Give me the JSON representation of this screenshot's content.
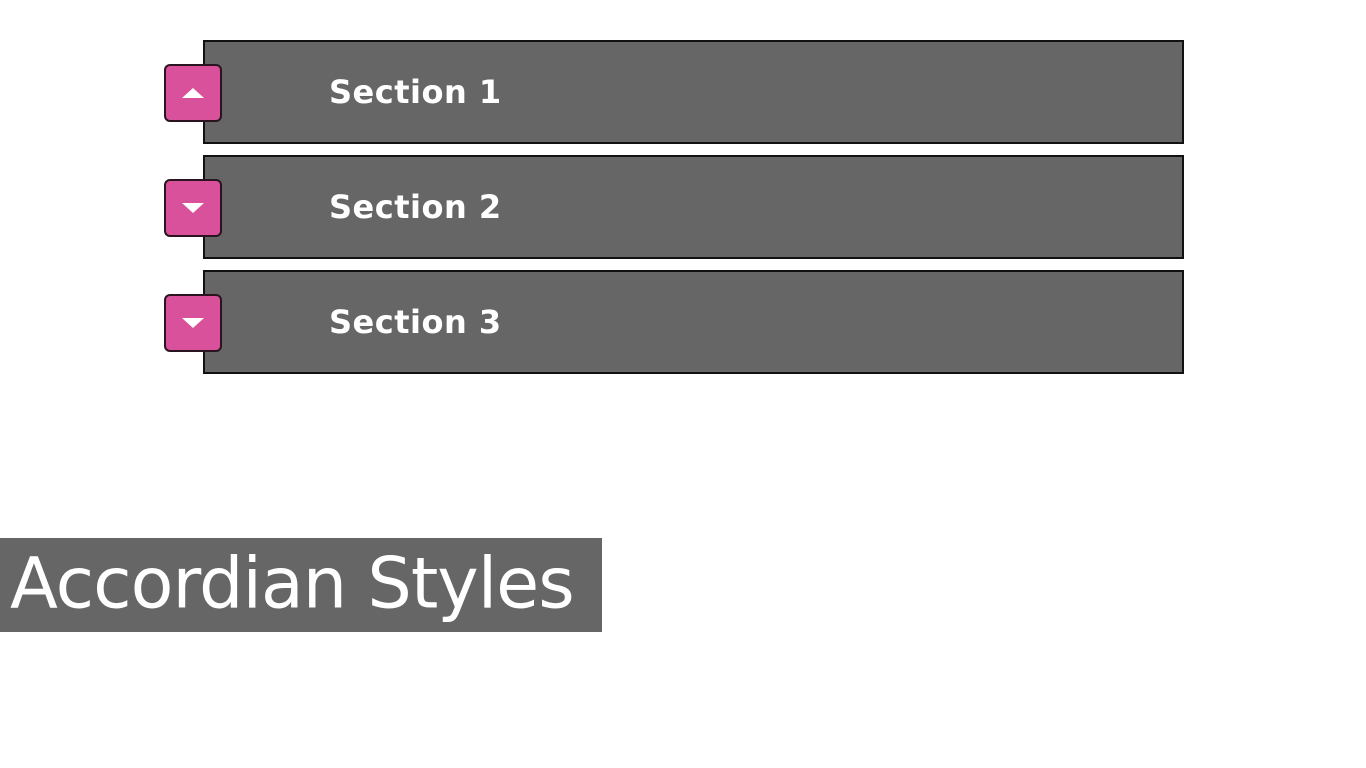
{
  "accordion": {
    "sections": [
      {
        "label": "Section 1",
        "state": "expanded",
        "icon": "chevron-up-icon"
      },
      {
        "label": "Section 2",
        "state": "collapsed",
        "icon": "chevron-down-icon"
      },
      {
        "label": "Section 3",
        "state": "collapsed",
        "icon": "chevron-down-icon"
      }
    ]
  },
  "caption": {
    "text": "Accordian Styles"
  },
  "colors": {
    "header_bg": "#666666",
    "toggle_bg": "#d9519a",
    "text": "#ffffff",
    "border": "#111111"
  }
}
